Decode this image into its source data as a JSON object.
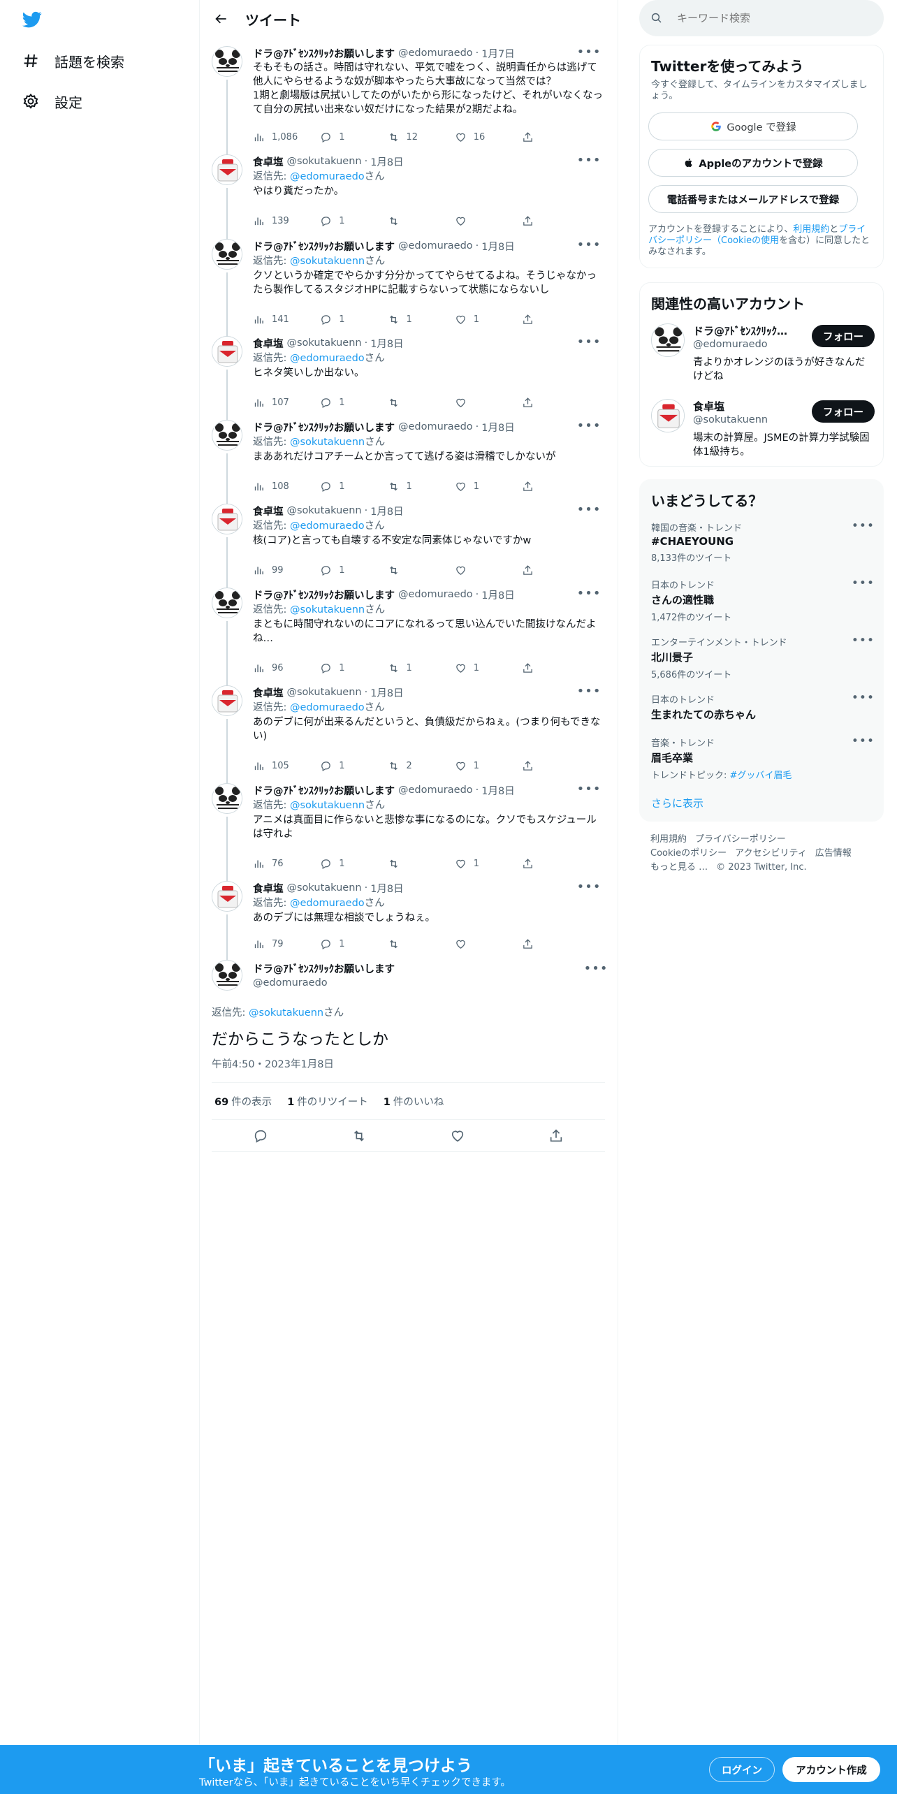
{
  "nav": {
    "explore_label": "話題を検索",
    "settings_label": "設定"
  },
  "header": {
    "title": "ツイート"
  },
  "thread": [
    {
      "avatar": "panda-avatar",
      "name": "ドラ@ｱﾄﾞｾﾝｽｸﾘｯｸお願いします",
      "handle": "@edomuraedo",
      "date": "1月7日",
      "reply_to": "",
      "text": "そもそもの話さ。時間は守れない、平気で嘘をつく、説明責任からは逃げて他人にやらせるような奴が脚本やったら大事故になって当然では？\n1期と劇場版は尻拭いしてたのがいたから形になったけど、それがいなくなって自分の尻拭い出来ない奴だけになった結果が2期だよね。",
      "views": "1,086",
      "replies": "1",
      "retweets": "12",
      "likes": "16"
    },
    {
      "avatar": "salt-avatar",
      "name": "食卓塩",
      "handle": "@sokutakuenn",
      "date": "1月8日",
      "reply_to": "@edomuraedo",
      "text": "やはり糞だったか。",
      "views": "139",
      "replies": "1",
      "retweets": "",
      "likes": ""
    },
    {
      "avatar": "panda-avatar",
      "name": "ドラ@ｱﾄﾞｾﾝｽｸﾘｯｸお願いします",
      "handle": "@edomuraedo",
      "date": "1月8日",
      "reply_to": "@sokutakuenn",
      "text": "クソというか確定でやらかす分分かっててやらせてるよね。そうじゃなかったら製作してるスタジオHPに記載すらないって状態にならないし",
      "views": "141",
      "replies": "1",
      "retweets": "1",
      "likes": "1"
    },
    {
      "avatar": "salt-avatar",
      "name": "食卓塩",
      "handle": "@sokutakuenn",
      "date": "1月8日",
      "reply_to": "@edomuraedo",
      "text": "ヒネタ笑いしか出ない。",
      "views": "107",
      "replies": "1",
      "retweets": "",
      "likes": ""
    },
    {
      "avatar": "panda-avatar",
      "name": "ドラ@ｱﾄﾞｾﾝｽｸﾘｯｸお願いします",
      "handle": "@edomuraedo",
      "date": "1月8日",
      "reply_to": "@sokutakuenn",
      "text": "まああれだけコアチームとか言ってて逃げる姿は滑稽でしかないが",
      "views": "108",
      "replies": "1",
      "retweets": "1",
      "likes": "1"
    },
    {
      "avatar": "salt-avatar",
      "name": "食卓塩",
      "handle": "@sokutakuenn",
      "date": "1月8日",
      "reply_to": "@edomuraedo",
      "text": "核(コア)と言っても自壊する不安定な同素体じゃないですかw",
      "views": "99",
      "replies": "1",
      "retweets": "",
      "likes": ""
    },
    {
      "avatar": "panda-avatar",
      "name": "ドラ@ｱﾄﾞｾﾝｽｸﾘｯｸお願いします",
      "handle": "@edomuraedo",
      "date": "1月8日",
      "reply_to": "@sokutakuenn",
      "text": "まともに時間守れないのにコアになれるって思い込んでいた間抜けなんだよね…",
      "views": "96",
      "replies": "1",
      "retweets": "1",
      "likes": "1"
    },
    {
      "avatar": "salt-avatar",
      "name": "食卓塩",
      "handle": "@sokutakuenn",
      "date": "1月8日",
      "reply_to": "@edomuraedo",
      "text": "あのデブに何が出来るんだというと、負債級だからねぇ。(つまり何もできない)",
      "views": "105",
      "replies": "1",
      "retweets": "2",
      "likes": "1"
    },
    {
      "avatar": "panda-avatar",
      "name": "ドラ@ｱﾄﾞｾﾝｽｸﾘｯｸお願いします",
      "handle": "@edomuraedo",
      "date": "1月8日",
      "reply_to": "@sokutakuenn",
      "text": "アニメは真面目に作らないと悲惨な事になるのにな。クソでもスケジュールは守れよ",
      "views": "76",
      "replies": "1",
      "retweets": "",
      "likes": "1"
    },
    {
      "avatar": "salt-avatar",
      "name": "食卓塩",
      "handle": "@sokutakuenn",
      "date": "1月8日",
      "reply_to": "@edomuraedo",
      "text": "あのデブには無理な相談でしょうねぇ。",
      "views": "79",
      "replies": "1",
      "retweets": "",
      "likes": ""
    }
  ],
  "reply_prefix": "返信先: ",
  "reply_suffix": "さん",
  "focus": {
    "name": "ドラ@ｱﾄﾞｾﾝｽｸﾘｯｸお願いします",
    "handle": "@edomuraedo",
    "reply_to": "@sokutakuenn",
    "text": "だからこうなったとしか",
    "time": "午前4:50・2023年1月8日",
    "views_count": "69",
    "views_label": "件の表示",
    "retweets_count": "1",
    "retweets_label": "件のリツイート",
    "likes_count": "1",
    "likes_label": "件のいいね"
  },
  "search": {
    "placeholder": "キーワード検索"
  },
  "signup": {
    "title": "Twitterを使ってみよう",
    "subtitle": "今すぐ登録して、タイムラインをカスタマイズしましょう。",
    "google": "Google で登録",
    "apple": "Appleのアカウントで登録",
    "phone": "電話番号またはメールアドレスで登録",
    "terms_pre": "アカウントを登録することにより、",
    "terms_link1": "利用規約",
    "terms_mid": "と",
    "terms_link2": "プライバシーポリシー（Cookieの使用",
    "terms_post": "を含む）に同意したとみなされます。"
  },
  "related": {
    "title": "関連性の高いアカウント",
    "accounts": [
      {
        "name": "ドラ@ｱﾄﾞｾﾝｽｸﾘｯｸお願いします",
        "handle": "@edomuraedo",
        "bio": "青よりかオレンジのほうが好きなんだけどね",
        "follow": "フォロー"
      },
      {
        "name": "食卓塩",
        "handle": "@sokutakuenn",
        "bio": "場末の計算屋。JSMEの計算力学試験固体1級持ち。",
        "follow": "フォロー"
      }
    ]
  },
  "trends": {
    "title": "いまどうしてる？",
    "items": [
      {
        "context": "韓国の音楽・トレンド",
        "name": "#CHAEYOUNG",
        "count": "8,133件のツイート"
      },
      {
        "context": "日本のトレンド",
        "name": "さんの適性職",
        "count": "1,472件のツイート"
      },
      {
        "context": "エンターテインメント・トレンド",
        "name": "北川景子",
        "count": "5,686件のツイート"
      },
      {
        "context": "日本のトレンド",
        "name": "生まれたての赤ちゃん",
        "count": ""
      },
      {
        "context": "音楽・トレンド",
        "name": "眉毛卒業",
        "count": "トレンドトピック: ",
        "topic": "#グッバイ眉毛"
      }
    ],
    "show_more": "さらに表示"
  },
  "footer": {
    "l1": [
      "利用規約",
      "プライバシーポリシー"
    ],
    "l2": [
      "Cookieのポリシー",
      "アクセシビリティ",
      "広告情報"
    ],
    "l3": [
      "もっと見る …",
      "© 2023 Twitter, Inc."
    ]
  },
  "bottom": {
    "title": "「いま」起きていることを見つけよう",
    "subtitle": "Twitterなら、「いま」起きていることをいち早くチェックできます。",
    "login": "ログイン",
    "signup": "アカウント作成"
  },
  "colors": {
    "accent": "#1d9bf0",
    "text": "#0f1419",
    "muted": "#536471",
    "border": "#eff3f4"
  }
}
